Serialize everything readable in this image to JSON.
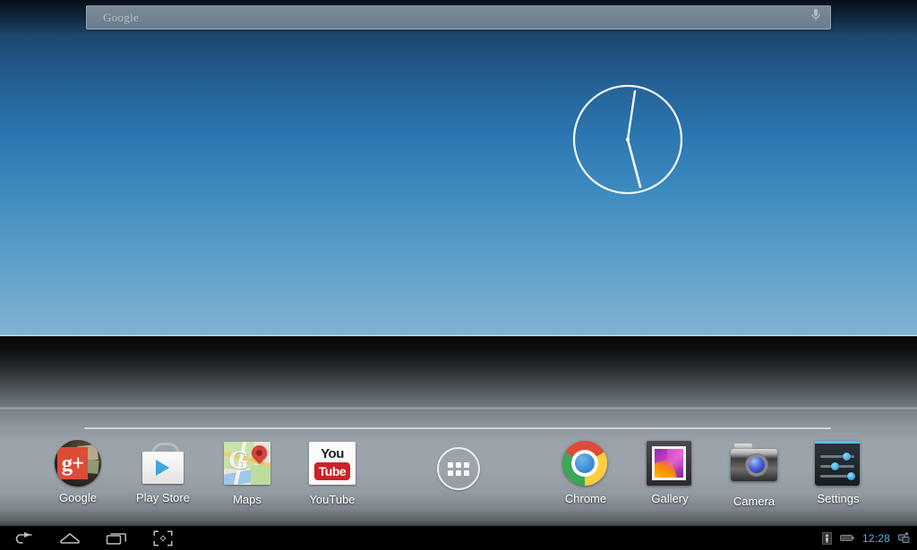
{
  "search_widget": {
    "placeholder": "Google",
    "mic_icon": "microphone-icon"
  },
  "clock_widget": {
    "name": "analog-clock",
    "hour_hand_deg": 8,
    "minute_hand_deg": 168,
    "displayed_time": "12:28"
  },
  "dock": {
    "left_apps": [
      {
        "label": "Google",
        "icon": "google-plus-icon"
      },
      {
        "label": "Play Store",
        "icon": "play-store-icon"
      },
      {
        "label": "Maps",
        "icon": "maps-icon"
      },
      {
        "label": "YouTube",
        "icon": "youtube-icon"
      }
    ],
    "app_drawer": {
      "label": "",
      "icon": "apps-grid-icon"
    },
    "right_apps": [
      {
        "label": "Chrome",
        "icon": "chrome-icon"
      },
      {
        "label": "Gallery",
        "icon": "gallery-icon"
      },
      {
        "label": "Camera",
        "icon": "camera-icon"
      },
      {
        "label": "Settings",
        "icon": "settings-sliders-icon"
      }
    ]
  },
  "system_bar": {
    "nav_buttons": [
      {
        "name": "back-button",
        "icon": "back-arrow-icon"
      },
      {
        "name": "home-button",
        "icon": "home-icon"
      },
      {
        "name": "recents-button",
        "icon": "recent-apps-icon"
      },
      {
        "name": "screenshot-button",
        "icon": "screenshot-icon"
      }
    ],
    "status": {
      "usb_icon": "usb-debug-icon",
      "battery_icon": "battery-icon",
      "time": "12:28",
      "notification_icon": "screenshot-notification-icon"
    }
  },
  "colors": {
    "sky_top": "#12243a",
    "sky_bottom": "#7fb2d2",
    "ground_mid": "#9aa3a9",
    "clock_accent": "#4fb8e0",
    "chrome_red": "#dd4b39",
    "chrome_yellow": "#ffcd40",
    "chrome_green": "#3aa757",
    "chrome_blue": "#1a73c8",
    "youtube_red": "#cc2229",
    "settings_blue": "#4fc3f7"
  }
}
